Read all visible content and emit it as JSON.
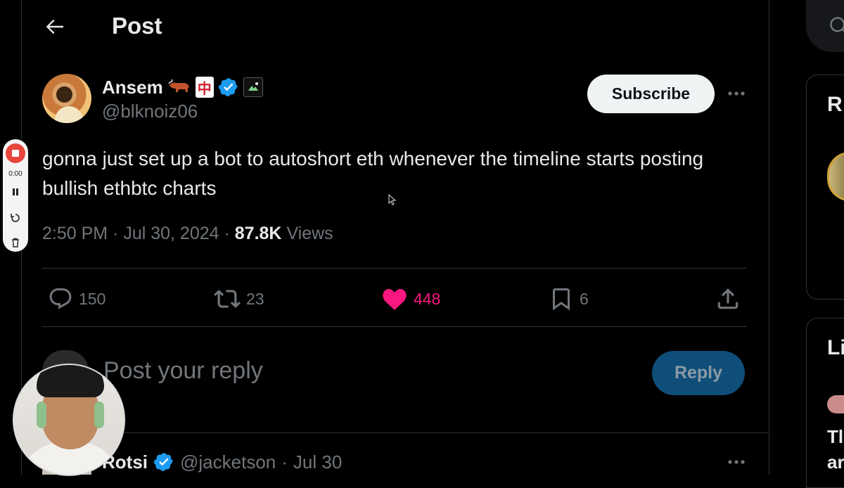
{
  "header": {
    "title": "Post",
    "back_icon": "arrow-left-icon"
  },
  "author": {
    "name": "Ansem",
    "name_emojis": [
      "ox-emoji",
      "mahjong-red-dragon-emoji"
    ],
    "mahjong_glyph": "中",
    "verified": true,
    "handle": "@blknoiz06",
    "subscribe_label": "Subscribe"
  },
  "post": {
    "text": "gonna just set up a bot to autoshort eth whenever the timeline starts posting bullish ethbtc charts",
    "time": "2:50 PM",
    "date": "Jul 30, 2024",
    "views_count": "87.8K",
    "views_label": "Views"
  },
  "actions": {
    "replies": "150",
    "reposts": "23",
    "likes": "448",
    "bookmarks": "6",
    "like_color": "#f91880"
  },
  "composer": {
    "placeholder": "Post your reply",
    "reply_label": "Reply"
  },
  "reply_tweet": {
    "name": "Rotsi",
    "handle": "@jacketson",
    "date": "Jul 30"
  },
  "recorder": {
    "time": "0:00"
  },
  "sidebar": {
    "card1_title": "R",
    "card2_title": "Li",
    "card2_line1": "Tl",
    "card2_line2": "ar"
  },
  "colors": {
    "background": "#000000",
    "text": "#e7e9ea",
    "muted": "#71767b",
    "verified": "#1d9bf0",
    "reply_button": "#0f4e78"
  }
}
